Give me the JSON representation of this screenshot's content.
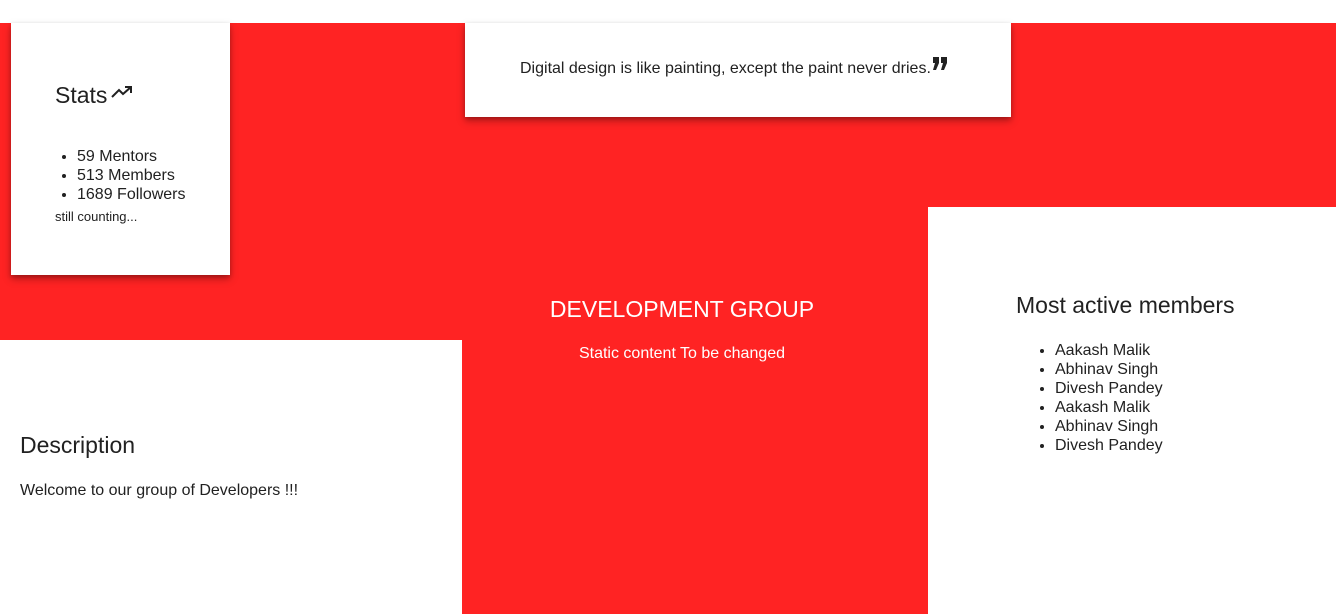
{
  "stats": {
    "title": "Stats",
    "icon": "trending-up-icon",
    "items": [
      "59 Mentors",
      "513 Members",
      "1689 Followers"
    ],
    "note": "still counting..."
  },
  "quote": {
    "text": "Digital design is like painting, except the paint never dries.",
    "icon": "format-quote-icon"
  },
  "group": {
    "title": "DEVELOPMENT GROUP",
    "subtitle": "Static content To be changed"
  },
  "description": {
    "title": "Description",
    "text": "Welcome to our group of Developers !!!"
  },
  "members": {
    "title": "Most active members",
    "items": [
      "Aakash Malik",
      "Abhinav Singh",
      "Divesh Pandey",
      "Aakash Malik",
      "Abhinav Singh",
      "Divesh Pandey"
    ]
  },
  "colors": {
    "accent": "#ff2323",
    "card": "#ffffff",
    "text": "#212121"
  }
}
